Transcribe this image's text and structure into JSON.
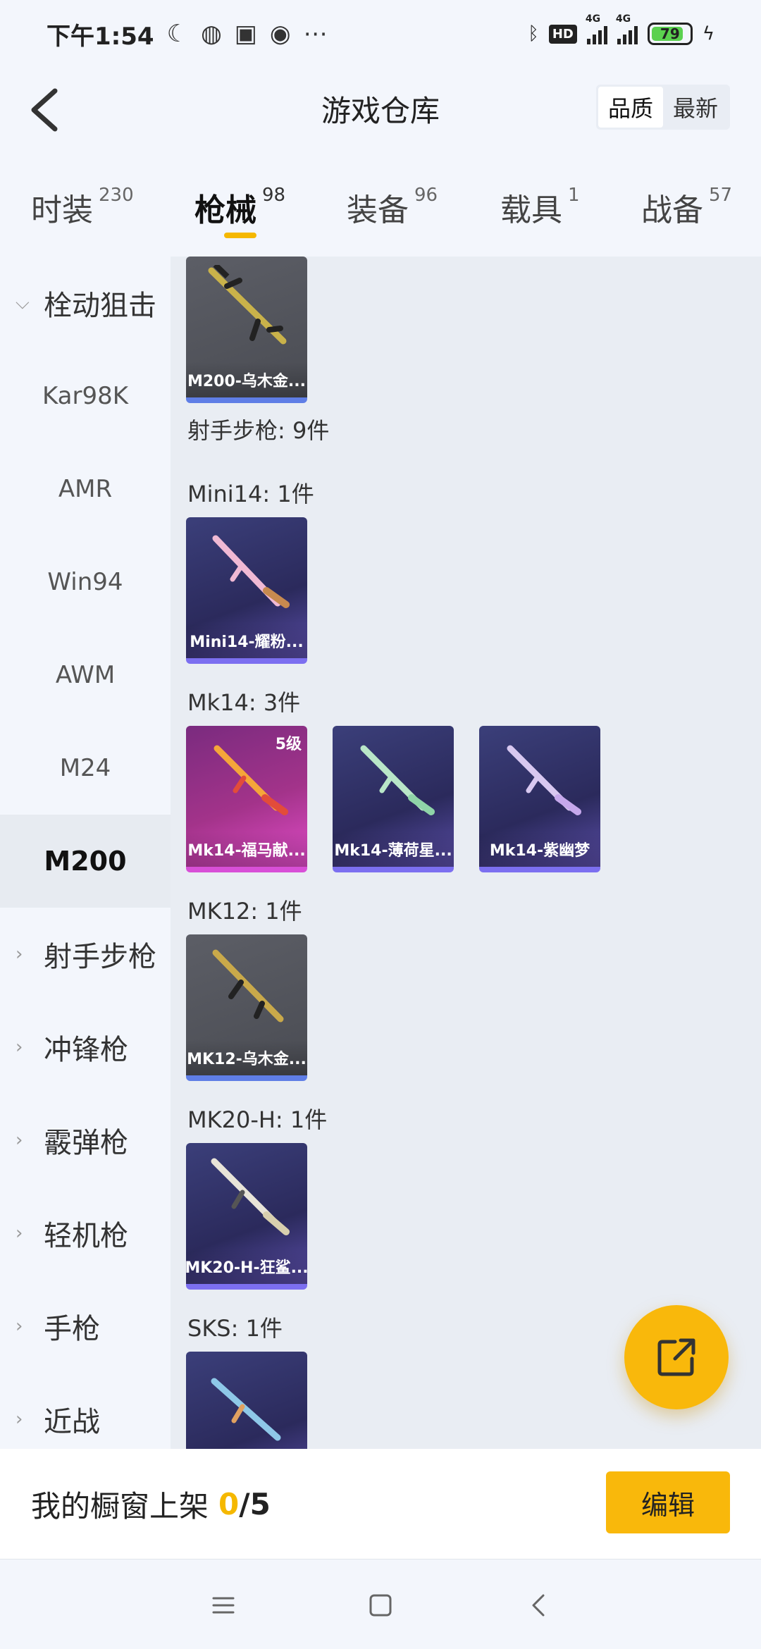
{
  "status_bar": {
    "time": "下午1:54",
    "battery": "79",
    "left_icons": [
      "moon-icon",
      "globe-icon",
      "message-icon",
      "qq-icon",
      "more-icon"
    ],
    "right_icons": [
      "bluetooth-icon",
      "hd-icon",
      "signal-icon",
      "signal-icon",
      "battery-icon",
      "charging-icon"
    ],
    "hd": "HD",
    "net1": "4G",
    "net2": "4G"
  },
  "header": {
    "title": "游戏仓库",
    "sort_options": [
      "品质",
      "最新"
    ],
    "active_sort": "品质"
  },
  "tabs": [
    {
      "label": "时装",
      "count": "230"
    },
    {
      "label": "枪械",
      "count": "98",
      "active": true
    },
    {
      "label": "装备",
      "count": "96"
    },
    {
      "label": "载具",
      "count": "1"
    },
    {
      "label": "战备",
      "count": "57"
    }
  ],
  "sidebar": {
    "items": [
      {
        "label": "栓动狙击",
        "type": "group",
        "expanded": true
      },
      {
        "label": "Kar98K",
        "type": "sub"
      },
      {
        "label": "AMR",
        "type": "sub"
      },
      {
        "label": "Win94",
        "type": "sub"
      },
      {
        "label": "AWM",
        "type": "sub"
      },
      {
        "label": "M24",
        "type": "sub"
      },
      {
        "label": "M200",
        "type": "sub",
        "selected": true
      },
      {
        "label": "射手步枪",
        "type": "group"
      },
      {
        "label": "冲锋枪",
        "type": "group"
      },
      {
        "label": "霰弹枪",
        "type": "group"
      },
      {
        "label": "轻机枪",
        "type": "group"
      },
      {
        "label": "手枪",
        "type": "group"
      },
      {
        "label": "近战",
        "type": "group"
      }
    ]
  },
  "content": {
    "category_heading": "射手步枪: 9件",
    "sections": [
      {
        "heading": "",
        "items": [
          {
            "name": "M200-乌木金...",
            "rarity": "grey"
          }
        ]
      },
      {
        "heading": "Mini14: 1件",
        "items": [
          {
            "name": "Mini14-耀粉...",
            "rarity": "purple"
          }
        ]
      },
      {
        "heading": "Mk14: 3件",
        "items": [
          {
            "name": "Mk14-福马献...",
            "rarity": "pink",
            "level": "5级"
          },
          {
            "name": "Mk14-薄荷星...",
            "rarity": "purple"
          },
          {
            "name": "Mk14-紫幽梦",
            "rarity": "purple"
          }
        ]
      },
      {
        "heading": "MK12: 1件",
        "items": [
          {
            "name": "MK12-乌木金...",
            "rarity": "grey"
          }
        ]
      },
      {
        "heading": "MK20-H: 1件",
        "items": [
          {
            "name": "MK20-H-狂鲨...",
            "rarity": "purple"
          }
        ]
      },
      {
        "heading": "SKS: 1件",
        "items": [
          {
            "name": "",
            "rarity": "purple"
          }
        ]
      }
    ]
  },
  "fab": {
    "icon": "share-icon"
  },
  "shelf": {
    "label": "我的橱窗上架",
    "current": "0",
    "separator": "/",
    "max": "5",
    "edit_label": "编辑"
  },
  "navbar": {
    "icons": [
      "menu-icon",
      "home-icon",
      "back-icon"
    ]
  },
  "colors": {
    "accent": "#f9b80b",
    "background": "#f3f6fc",
    "content_bg": "#e9edf3"
  }
}
